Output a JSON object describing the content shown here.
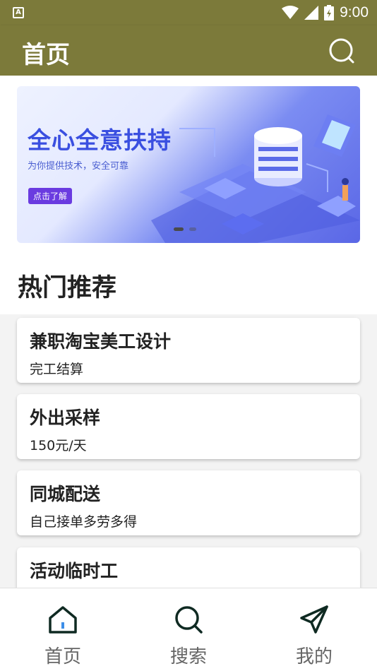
{
  "status_bar": {
    "left_icon_label": "A",
    "time": "9:00",
    "icons": [
      "wifi-icon",
      "signal-icon",
      "battery-icon"
    ]
  },
  "app_bar": {
    "title": "首页",
    "search_icon": "search-icon"
  },
  "banner": {
    "headline": "全心全意扶持",
    "subtitle": "为你提供技术，安全可靠",
    "cta": "点击了解",
    "dots": 2,
    "active_dot": 1
  },
  "section": {
    "title": "热门推荐"
  },
  "cards": [
    {
      "title": "兼职淘宝美工设计",
      "subtitle": "完工结算"
    },
    {
      "title": "外出采样",
      "subtitle": "150元/天"
    },
    {
      "title": "同城配送",
      "subtitle": "自己接单多劳多得"
    },
    {
      "title": "活动临时工",
      "subtitle": ""
    }
  ],
  "bottom_nav": [
    {
      "label": "首页",
      "icon": "home-icon"
    },
    {
      "label": "搜索",
      "icon": "search-icon"
    },
    {
      "label": "我的",
      "icon": "send-icon"
    }
  ],
  "colors": {
    "primary": "#7c7a3a",
    "icon_dark": "#0f2a22",
    "banner_blue": "#3a4fe0"
  }
}
